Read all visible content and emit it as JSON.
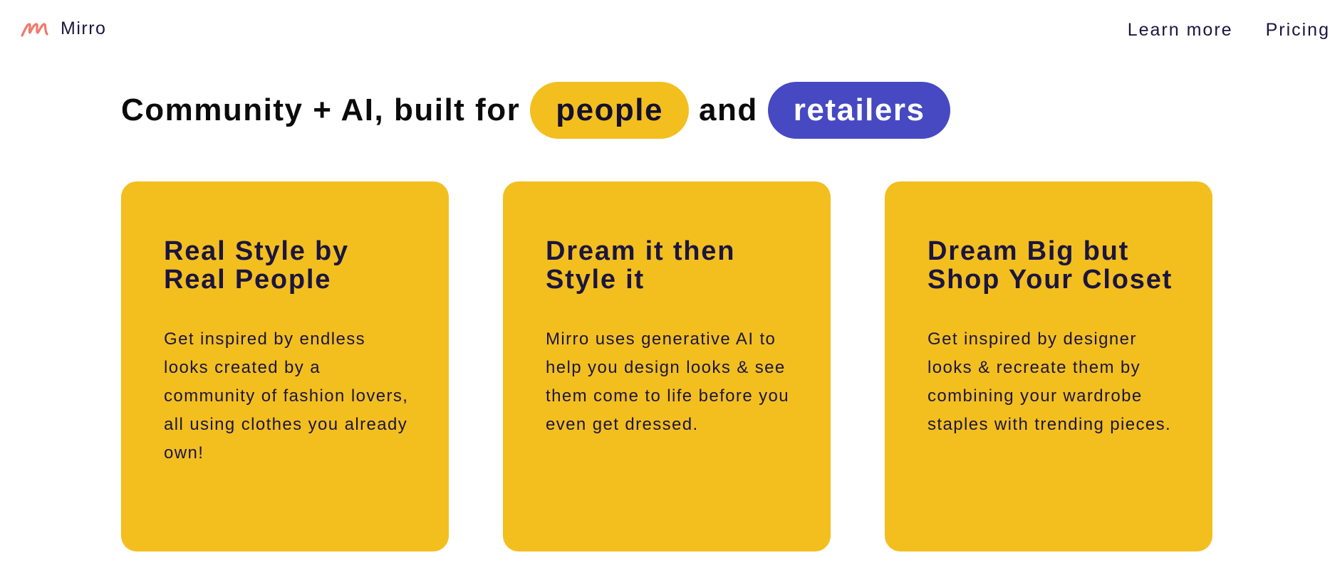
{
  "header": {
    "brand_name": "Mirro",
    "logo_icon": "mirro-logo-icon",
    "logo_color": "#f07b6c",
    "nav": [
      {
        "label": "Learn more"
      },
      {
        "label": "Pricing"
      }
    ]
  },
  "hero": {
    "prefix": "Community + AI, built for",
    "pill_people": "people",
    "connector": "and",
    "pill_retailers": "retailers"
  },
  "colors": {
    "accent_yellow": "#f3bf1f",
    "accent_indigo": "#4649c2",
    "text_dark": "#1b1540"
  },
  "cards": [
    {
      "title": "Real Style by Real People",
      "text": "Get inspired by endless looks created by a community of fashion lovers, all using clothes you already own!"
    },
    {
      "title": "Dream it then Style it",
      "text": "Mirro uses generative AI to help you design looks & see them come to life before you even get dressed."
    },
    {
      "title": "Dream Big but Shop Your Closet",
      "text": "Get inspired by designer looks & recreate them by combining your wardrobe staples with trending pieces."
    }
  ]
}
